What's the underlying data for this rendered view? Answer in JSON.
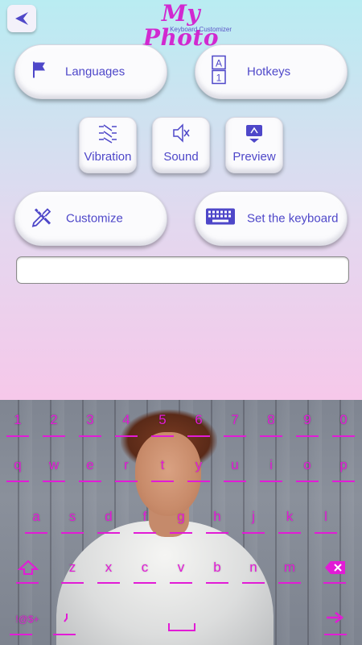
{
  "header": {
    "logo_title": "My Photo",
    "logo_subtitle": "Keyboard Customizer",
    "back_icon": "back-arrow-icon"
  },
  "menu": {
    "languages": "Languages",
    "hotkeys": "Hotkeys",
    "vibration": "Vibration",
    "sound": "Sound",
    "preview": "Preview",
    "customize": "Customize",
    "set_keyboard": "Set the keyboard"
  },
  "preview_input": {
    "value": "",
    "placeholder": ""
  },
  "keyboard": {
    "row_numbers": [
      "1",
      "2",
      "3",
      "4",
      "5",
      "6",
      "7",
      "8",
      "9",
      "0"
    ],
    "row1": [
      "q",
      "w",
      "e",
      "r",
      "t",
      "y",
      "u",
      "i",
      "o",
      "p"
    ],
    "row2": [
      "a",
      "s",
      "d",
      "f",
      "g",
      "h",
      "j",
      "k",
      "l"
    ],
    "row3": [
      "z",
      "x",
      "c",
      "v",
      "b",
      "n",
      "m"
    ],
    "symbols_label": "!@$+",
    "accent_color": "#e21bd6"
  },
  "colors": {
    "accent": "#4e47c9",
    "brand": "#d129d0"
  }
}
